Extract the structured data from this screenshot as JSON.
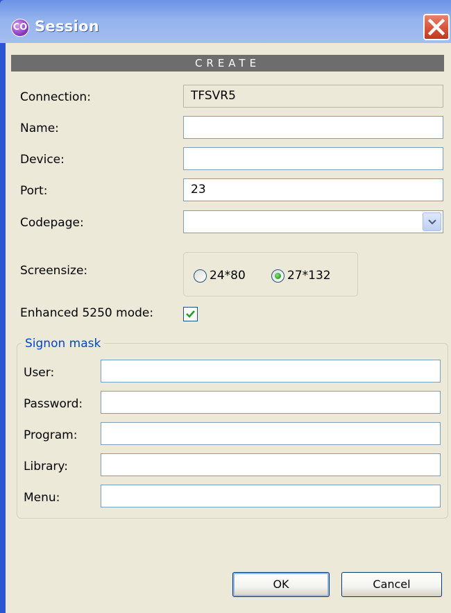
{
  "window": {
    "title": "Session"
  },
  "banner": {
    "text": "CREATE"
  },
  "form": {
    "connection_label": "Connection:",
    "connection_value": "TFSVR5",
    "name_label": "Name:",
    "name_value": "",
    "device_label": "Device:",
    "device_value": "",
    "port_label": "Port:",
    "port_value": "23",
    "codepage_label": "Codepage:",
    "codepage_value": "",
    "screensize_label": "Screensize:",
    "screensize_options": [
      {
        "label": "24*80",
        "selected": false
      },
      {
        "label": "27*132",
        "selected": true
      }
    ],
    "enhanced_label": "Enhanced 5250 mode:",
    "enhanced_checked": true
  },
  "signon": {
    "title": "Signon mask",
    "user_label": "User:",
    "user_value": "",
    "password_label": "Password:",
    "password_value": "",
    "program_label": "Program:",
    "program_value": "",
    "library_label": "Library:",
    "library_value": "",
    "menu_label": "Menu:",
    "menu_value": ""
  },
  "buttons": {
    "ok_label": "OK",
    "cancel_label": "Cancel"
  },
  "icons": {
    "app": "app-logo-icon",
    "close": "close-icon",
    "dropdown": "chevron-down-icon",
    "check": "checkmark-icon"
  },
  "colors": {
    "title_bar": "#94b3ee",
    "banner": "#6d6d6d",
    "group_title": "#0046d5",
    "close": "#d9563e",
    "radio_selected": "#21a121",
    "check": "#21a121"
  }
}
